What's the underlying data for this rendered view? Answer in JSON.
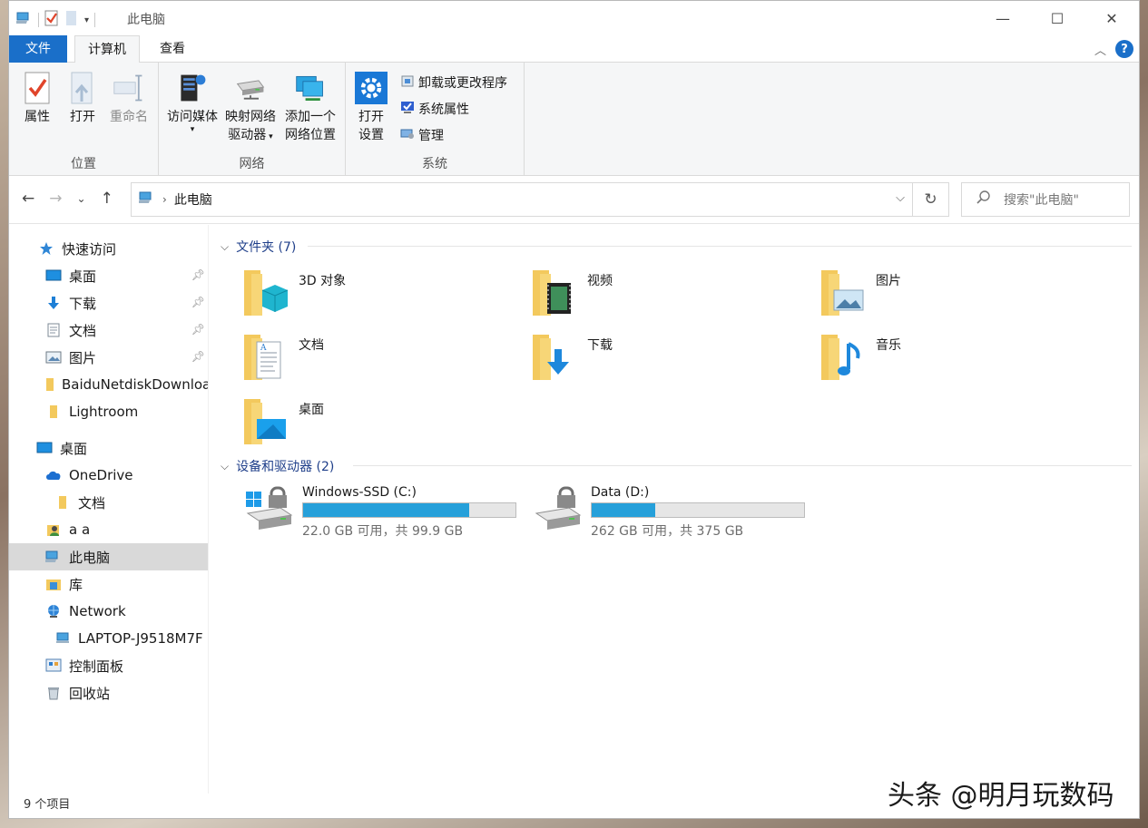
{
  "titlebar": {
    "title": "此电脑",
    "minimize": "—",
    "maximize": "☐",
    "close": "✕"
  },
  "tabs": {
    "file": "文件",
    "computer": "计算机",
    "view": "查看"
  },
  "ribbon": {
    "groups": {
      "location": "位置",
      "network": "网络",
      "system": "系统"
    },
    "properties": "属性",
    "open": "打开",
    "rename": "重命名",
    "access_media": "访问媒体",
    "map_drive_1": "映射网络",
    "map_drive_2": "驱动器",
    "add_location_1": "添加一个",
    "add_location_2": "网络位置",
    "open_settings_1": "打开",
    "open_settings_2": "设置",
    "uninstall": "卸载或更改程序",
    "sys_props": "系统属性",
    "manage": "管理"
  },
  "address": {
    "path": "此电脑",
    "search_placeholder": "搜索\"此电脑\""
  },
  "nav": {
    "quick_access": "快速访问",
    "desktop": "桌面",
    "downloads": "下载",
    "documents": "文档",
    "pictures": "图片",
    "baidu": "BaiduNetdiskDownload",
    "lightroom": "Lightroom",
    "desktop2": "桌面",
    "onedrive": "OneDrive",
    "od_documents": "文档",
    "user": "a a",
    "this_pc": "此电脑",
    "library": "库",
    "network": "Network",
    "laptop": "LAPTOP-J9518M7F",
    "control_panel": "控制面板",
    "recycle": "回收站"
  },
  "content": {
    "folders_header": "文件夹 (7)",
    "devices_header": "设备和驱动器 (2)",
    "folders": [
      "3D 对象",
      "视频",
      "图片",
      "文档",
      "下载",
      "音乐",
      "桌面"
    ],
    "drives": [
      {
        "name": "Windows-SSD (C:)",
        "free_text": "22.0 GB 可用，共 99.9 GB",
        "used_fraction": 0.78
      },
      {
        "name": "Data (D:)",
        "free_text": "262 GB 可用，共 375 GB",
        "used_fraction": 0.3
      }
    ]
  },
  "status": {
    "items": "9 个项目"
  },
  "watermark": "头条 @明月玩数码",
  "colors": {
    "accent": "#1a6fc9",
    "folder": "#f3c95d",
    "drive_fill": "#26a0da"
  }
}
